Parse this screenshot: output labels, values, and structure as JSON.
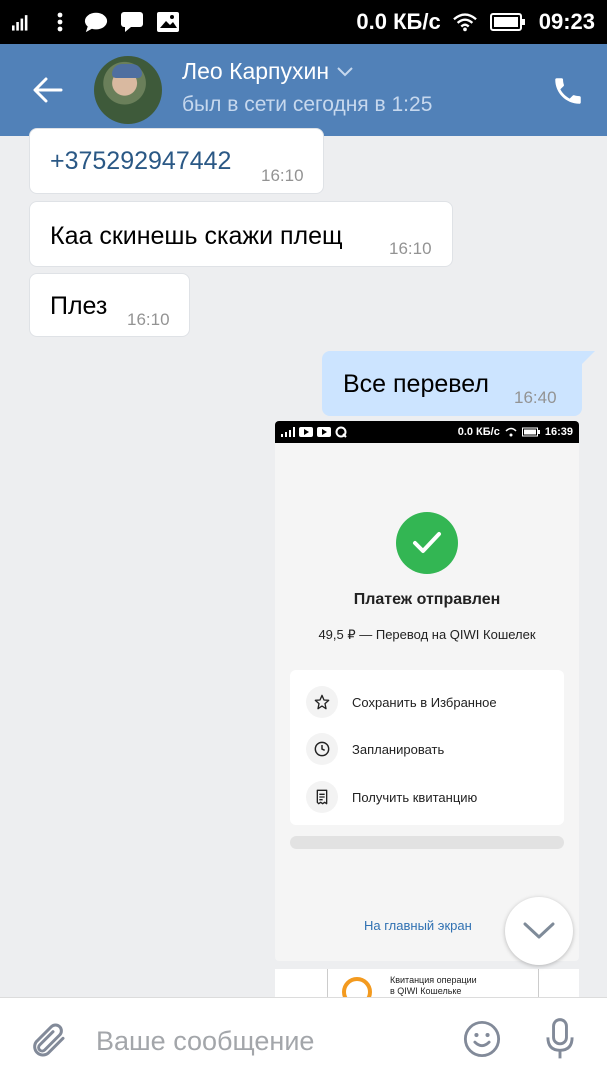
{
  "statusbar": {
    "network": "0.0 КБ/с",
    "time": "09:23"
  },
  "header": {
    "name": "Лео Карпухин",
    "status": "был в сети сегодня в 1:25"
  },
  "messages": [
    {
      "text": "+375292947442",
      "time": "16:10",
      "direction": "in",
      "is_link": true
    },
    {
      "text": "Каа скинешь скажи плещ",
      "time": "16:10",
      "direction": "in"
    },
    {
      "text": "Плез",
      "time": "16:10",
      "direction": "in"
    },
    {
      "text": "Все перевел",
      "time": "16:40",
      "direction": "out"
    }
  ],
  "screenshot": {
    "status_network": "0.0 КБ/с",
    "status_time": "16:39",
    "title": "Платеж отправлен",
    "subtitle": "49,5 ₽ — Перевод на QIWI Кошелек",
    "actions": [
      {
        "label": "Сохранить в Избранное",
        "icon": "star-icon"
      },
      {
        "label": "Запланировать",
        "icon": "clock-icon"
      },
      {
        "label": "Получить квитанцию",
        "icon": "receipt-icon"
      }
    ],
    "home_link": "На главный экран"
  },
  "receipt": {
    "line1": "Квитанция операции",
    "line2": "в QIWI Кошельке"
  },
  "composer": {
    "placeholder": "Ваше сообщение"
  },
  "colors": {
    "header": "#5181b8",
    "outgoing": "#cce4ff",
    "link": "#2a5885",
    "success": "#33b653"
  }
}
